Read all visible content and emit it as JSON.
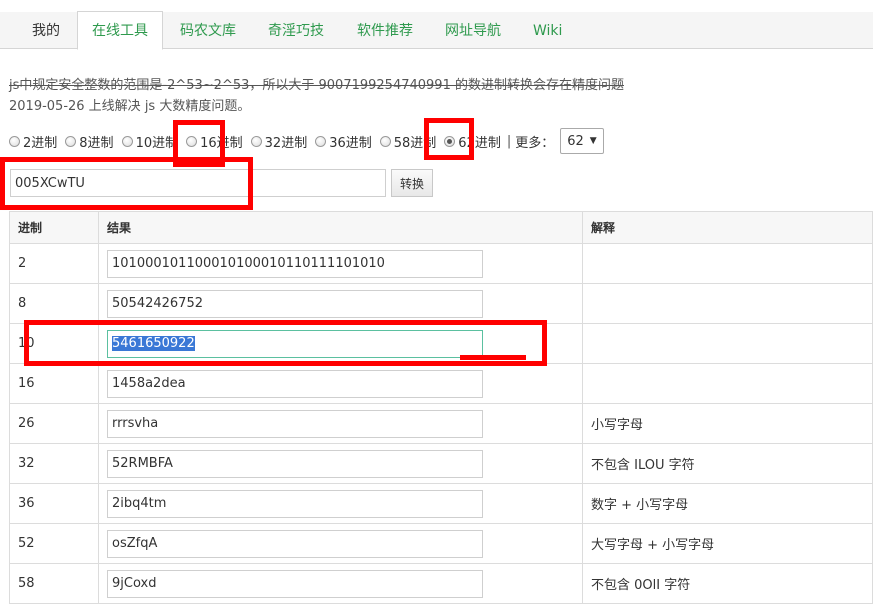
{
  "tabs": [
    {
      "label": "我的",
      "active": false
    },
    {
      "label": "在线工具",
      "active": true
    },
    {
      "label": "码农文库",
      "active": false
    },
    {
      "label": "奇淫巧技",
      "active": false
    },
    {
      "label": "软件推荐",
      "active": false
    },
    {
      "label": "网址导航",
      "active": false
    },
    {
      "label": "Wiki",
      "active": false
    }
  ],
  "notes": {
    "line1": "js中规定安全整数的范围是-2^53~2^53，所以大于 9007199254740991 的数进制转换会存在精度问题",
    "line2": "2019-05-26 上线解决 js 大数精度问题。"
  },
  "radios": [
    {
      "label": "2进制",
      "checked": false
    },
    {
      "label": "8进制",
      "checked": false
    },
    {
      "label": "10进制",
      "checked": false
    },
    {
      "label": "16进制",
      "checked": false
    },
    {
      "label": "32进制",
      "checked": false
    },
    {
      "label": "36进制",
      "checked": false
    },
    {
      "label": "58进制",
      "checked": false
    },
    {
      "label": "62进制",
      "checked": true
    }
  ],
  "more_label": "更多：",
  "more_select": "62",
  "input_value": "005XCwTU",
  "convert_button": "转换",
  "table": {
    "headers": [
      "进制",
      "结果",
      "解释"
    ],
    "rows": [
      {
        "base": "2",
        "result": "101000101100010100010110111101010",
        "note": ""
      },
      {
        "base": "8",
        "result": "50542426752",
        "note": ""
      },
      {
        "base": "10",
        "result": "5461650922",
        "note": ""
      },
      {
        "base": "16",
        "result": "1458a2dea",
        "note": ""
      },
      {
        "base": "26",
        "result": "rrrsvha",
        "note": "小写字母"
      },
      {
        "base": "32",
        "result": "52RMBFA",
        "note": "不包含 ILOU 字符"
      },
      {
        "base": "36",
        "result": "2ibq4tm",
        "note": "数字 + 小写字母"
      },
      {
        "base": "52",
        "result": "osZfqA",
        "note": "大写字母 + 小写字母"
      },
      {
        "base": "58",
        "result": "9jCoxd",
        "note": "不包含 0OlI 字符"
      }
    ]
  },
  "colors": {
    "accent": "#2f9a4e",
    "annotation": "#ff0000",
    "selection": "#3a78d6"
  }
}
